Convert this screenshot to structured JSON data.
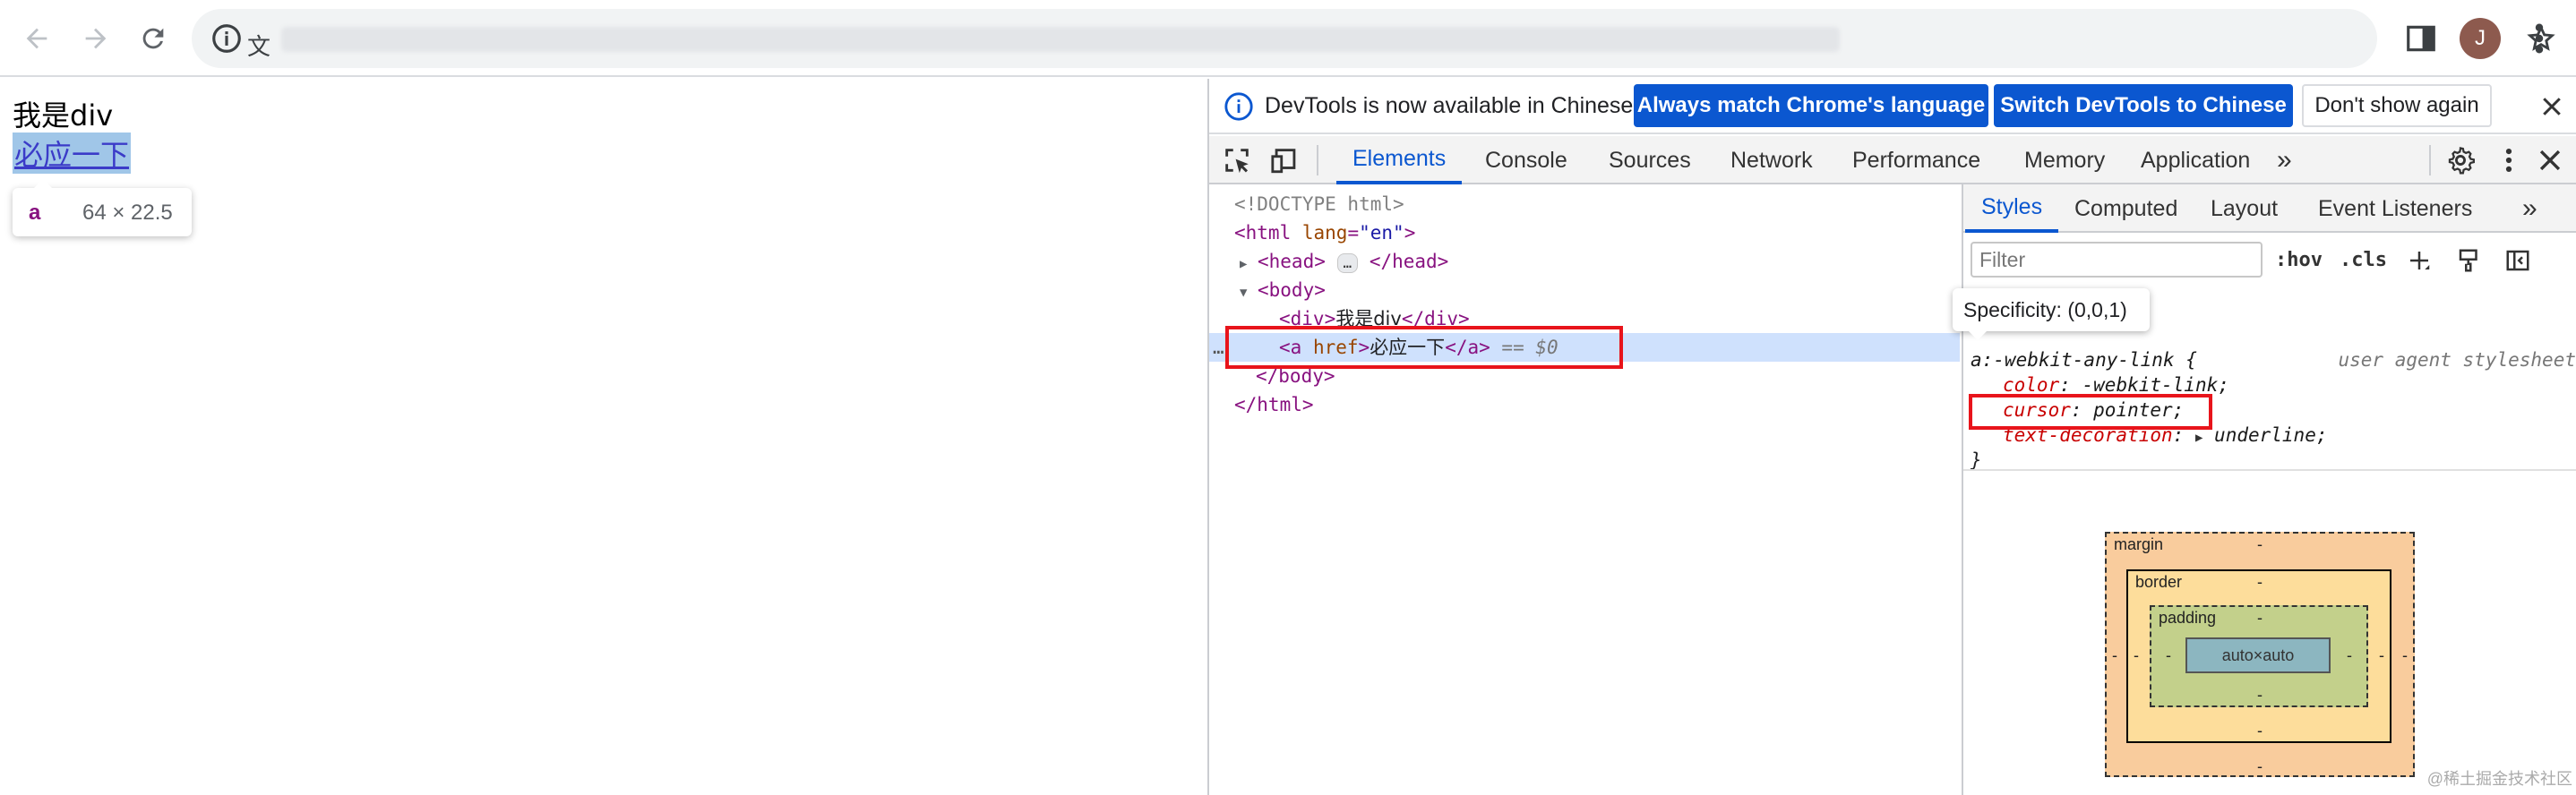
{
  "browser": {
    "translate_icon": "文",
    "avatar_letter": "J",
    "accent": "#0b57d0"
  },
  "page": {
    "div_text": "我是div",
    "link_text": "必应一下",
    "hover_tip": {
      "tag": "a",
      "size": "64 × 22.5"
    }
  },
  "devtools": {
    "infobar": {
      "message": "DevTools is now available in Chinese!",
      "btn_match": "Always match Chrome's language",
      "btn_switch": "Switch DevTools to Chinese",
      "btn_dismiss": "Don't show again"
    },
    "tabs": [
      "Elements",
      "Console",
      "Sources",
      "Network",
      "Performance",
      "Memory",
      "Application"
    ],
    "more_tabs": "»",
    "tree": {
      "doctype": "<!DOCTYPE html>",
      "html_open": "<html",
      "lang_attr": "lang",
      "lang_val": "\"en\"",
      "head_open": "<head>",
      "head_ellipsis": "…",
      "head_close": "</head>",
      "body_open": "<body>",
      "div_open": "<div>",
      "div_text": "我是div",
      "div_close": "</div>",
      "a_open": "<a",
      "a_attr": "href",
      "a_gt": ">",
      "a_text": "必应一下",
      "a_close": "</a>",
      "dollar": "== $0",
      "body_close": "</body>",
      "html_close": "</html>",
      "row_dots": "…"
    },
    "styles": {
      "tabs": [
        "Styles",
        "Computed",
        "Layout",
        "Event Listeners"
      ],
      "more_tabs": "»",
      "filter_placeholder": "Filter",
      "hov": ":hov",
      "cls": ".cls",
      "specificity_tip": "Specificity: (0,0,1)",
      "rule": {
        "selector": "a:-webkit-any-link {",
        "source": "user agent stylesheet",
        "props": [
          {
            "name": "color",
            "value": "-webkit-link;"
          },
          {
            "name": "cursor",
            "value": "pointer;"
          },
          {
            "name": "text-decoration",
            "value": "underline;"
          }
        ],
        "close": "}"
      },
      "box_model": {
        "margin_label": "margin",
        "border_label": "border",
        "padding_label": "padding",
        "content": "auto×auto",
        "dash": "-"
      }
    }
  },
  "watermark": "@稀土掘金技术社区"
}
